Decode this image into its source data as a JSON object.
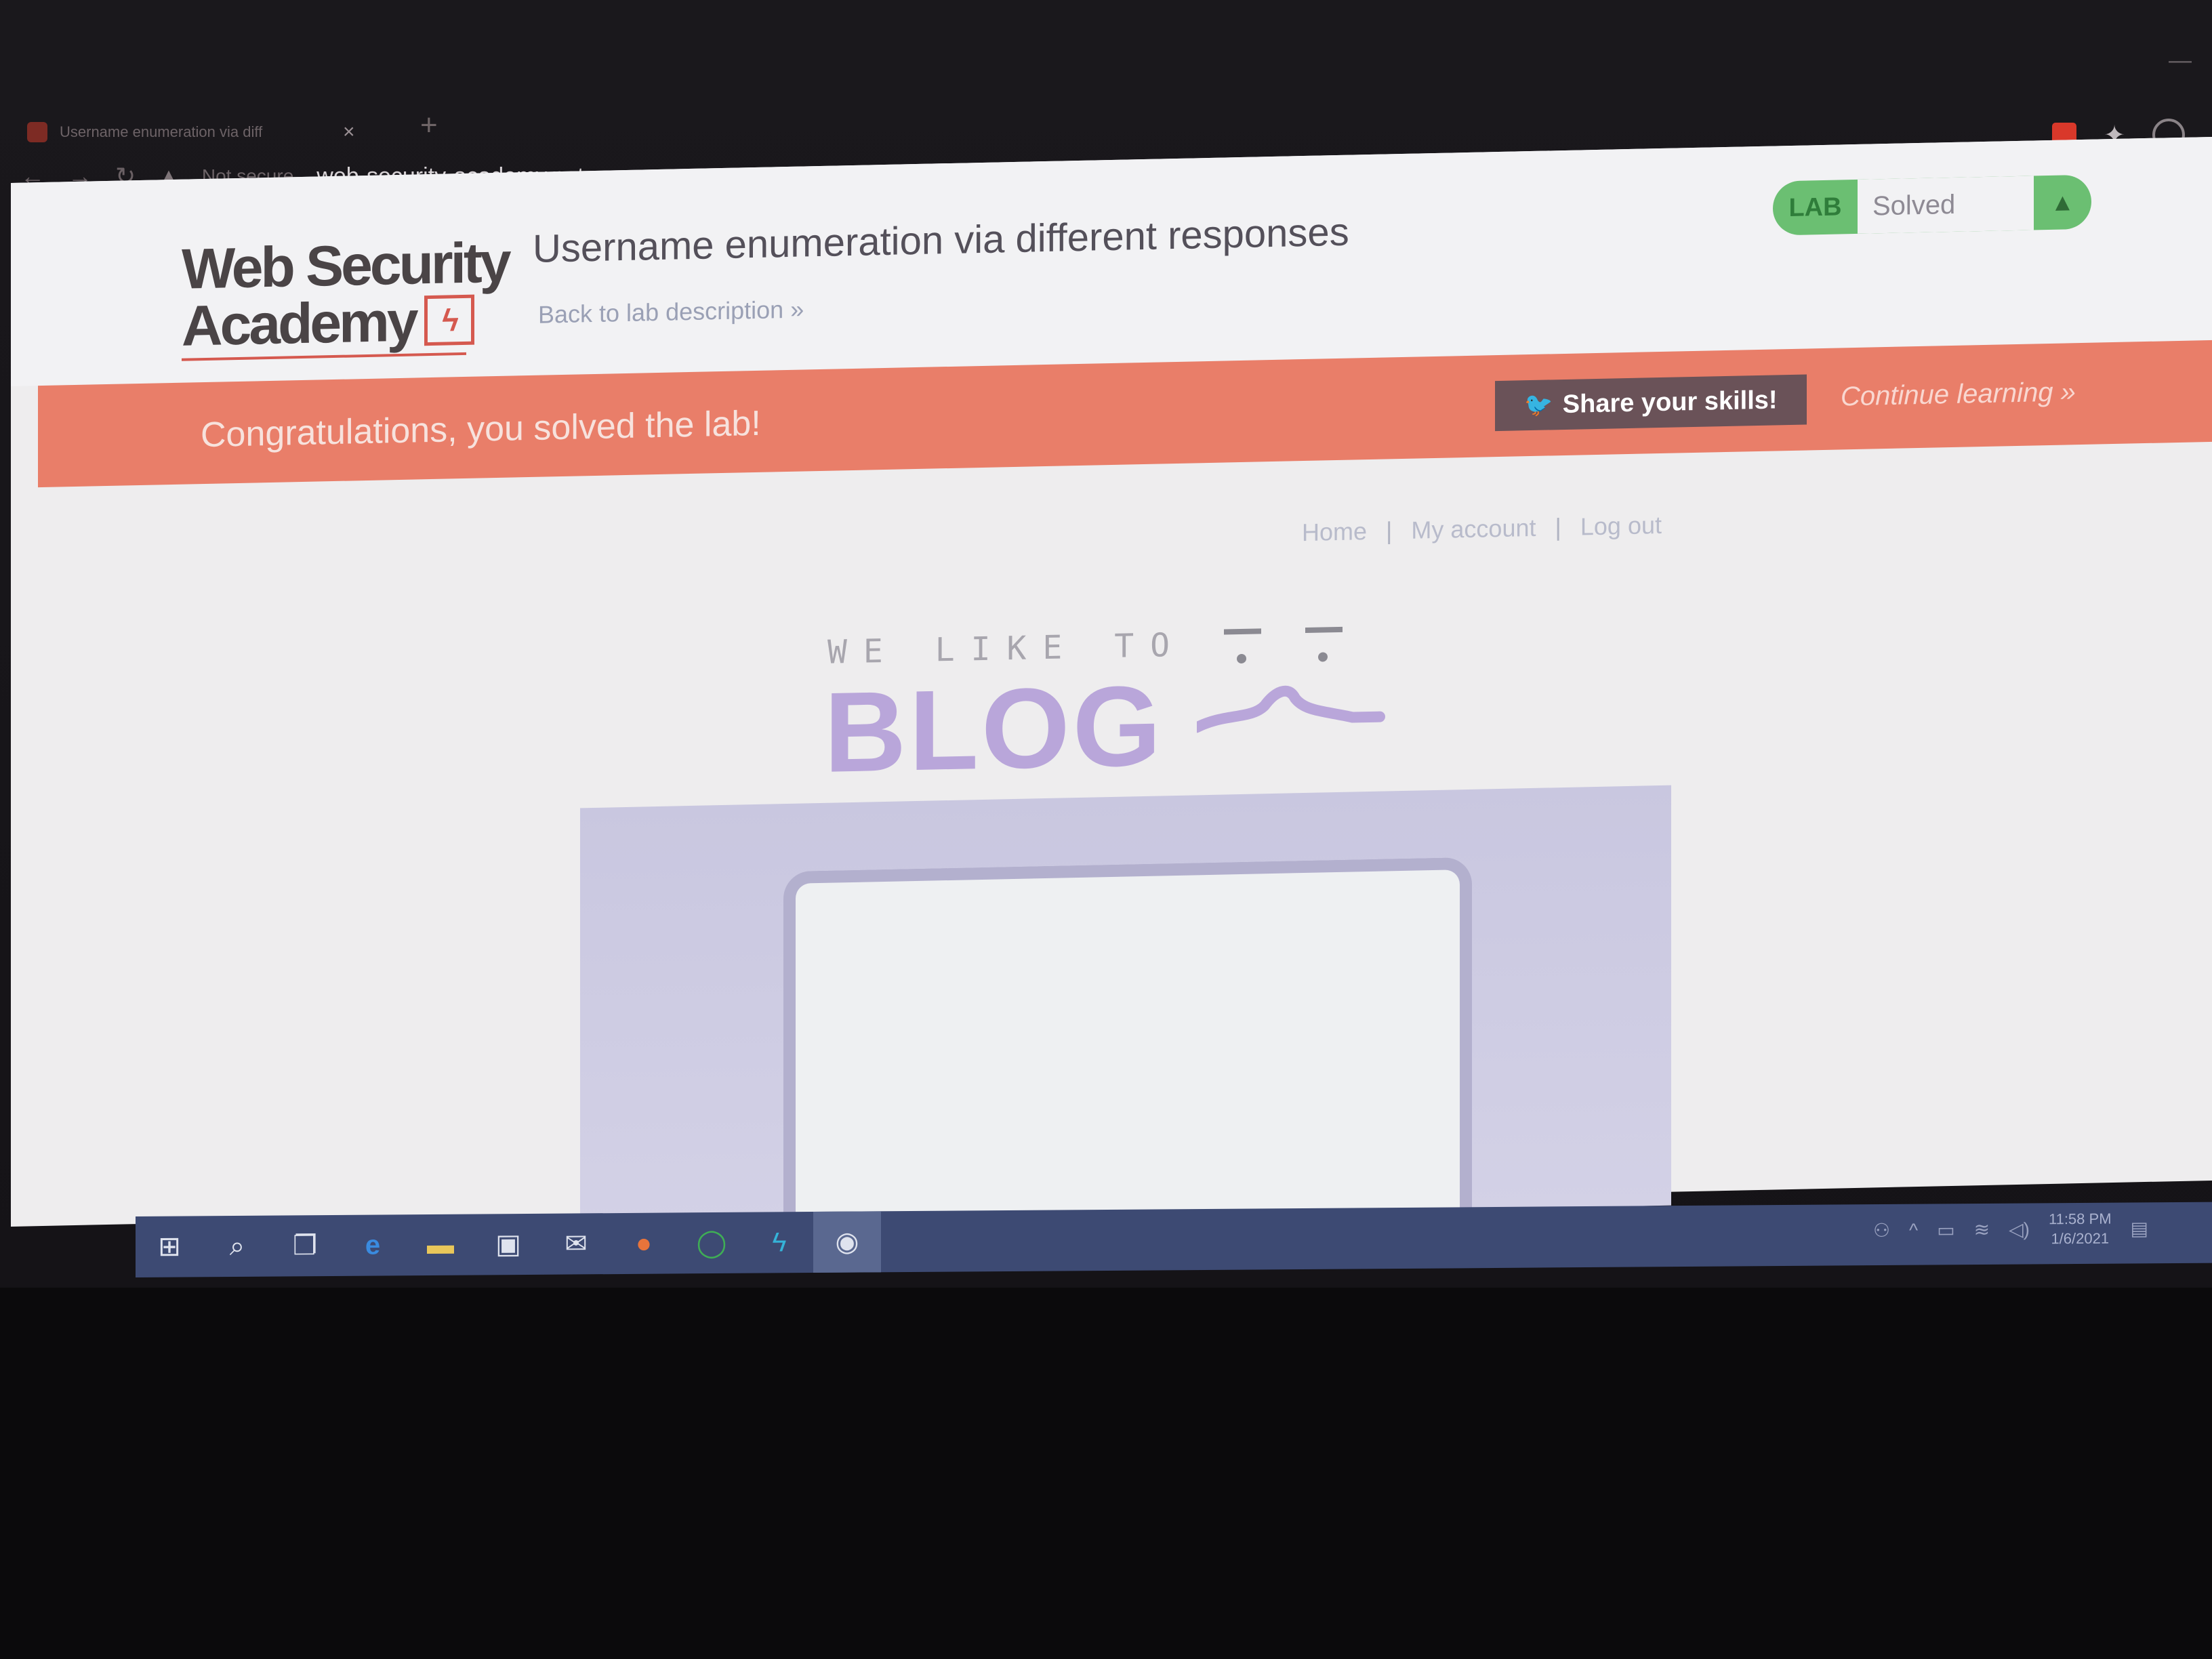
{
  "browser": {
    "tab_title": "Username enumeration via diff",
    "tab_close": "×",
    "new_tab": "+",
    "back": "←",
    "forward": "→",
    "reload": "↻",
    "warning_icon": "▲",
    "not_secure": "Not secure",
    "url": "web-security-academy.net"
  },
  "header": {
    "logo_line1": "Web Security",
    "logo_line2": "Academy",
    "lab_title": "Username enumeration via different responses",
    "back_link": "Back to lab description »",
    "badge_lab": "LAB",
    "badge_status": "Solved",
    "badge_icon": "▲"
  },
  "banner": {
    "congrats": "Congratulations, you solved the lab!",
    "share_label": "Share your skills!",
    "share_icon": "🐦",
    "continue": "Continue learning »"
  },
  "nav": {
    "home": "Home",
    "account": "My account",
    "logout": "Log out",
    "sep": "|"
  },
  "blog": {
    "tagline": "WE LIKE TO",
    "word": "BLOG"
  },
  "taskbar": {
    "icons": [
      "windows-start",
      "search",
      "task-view",
      "edge",
      "file-explorer",
      "store",
      "mail",
      "firefox",
      "green-circle",
      "blue-app",
      "active-app"
    ],
    "clock_time": "11:58 PM",
    "clock_date": "1/6/2021"
  }
}
